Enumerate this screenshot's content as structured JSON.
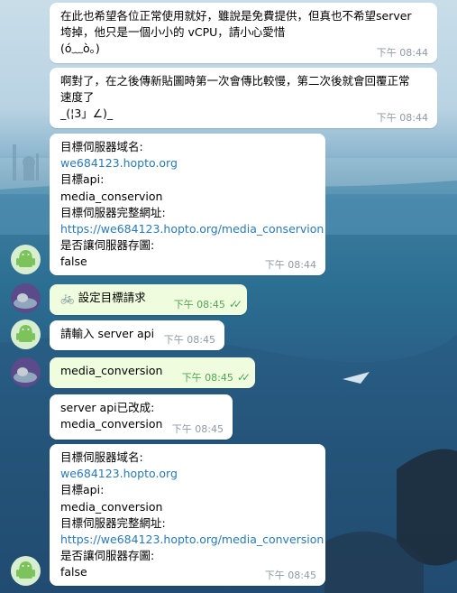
{
  "messages": {
    "m1": {
      "lines": [
        "在此也希望各位正常使用就好，雖說是免費提供，但真也不希望server",
        "垮掉，他只是一個小小的 vCPU，請小心愛惜",
        "(ó﹏ò｡)"
      ],
      "time": "下午 08:44"
    },
    "m2": {
      "lines": [
        "啊對了，在之後傳新貼圖時第一次會傳比較慢，第二次後就會回覆正常",
        "速度了",
        "_(¦3」∠)_"
      ],
      "time": "下午 08:44"
    },
    "m3": {
      "lines": [
        "目標伺服器域名:",
        "we684123.hopto.org",
        "目標api:",
        "media_conservion",
        "目標伺服器完整網址:",
        "https://we684123.hopto.org/media_conservion",
        "是否讓伺服器存圖:",
        "false"
      ],
      "time": "下午 08:44"
    },
    "m4": {
      "icon": "🚲",
      "text": "設定目標請求",
      "time": "下午 08:45",
      "status": "✓✓"
    },
    "m5": {
      "text": "請輸入 server api",
      "time": "下午 08:45"
    },
    "m6": {
      "text": "media_conversion",
      "time": "下午 08:45",
      "status": "✓✓"
    },
    "m7": {
      "lines": [
        "server api已改成:",
        "media_conversion"
      ],
      "time": "下午 08:45"
    },
    "m8": {
      "lines": [
        "目標伺服器域名:",
        "we684123.hopto.org",
        "目標api:",
        "media_conversion",
        "目標伺服器完整網址:",
        "https://we684123.hopto.org/media_conversion",
        "是否讓伺服器存圖:",
        "false"
      ],
      "time": "下午 08:45"
    }
  },
  "colors": {
    "incoming": "#ffffff",
    "outgoing": "#effdde",
    "link": "#2a79b8",
    "time": "#8e9aa5",
    "read_check": "#53a556"
  }
}
